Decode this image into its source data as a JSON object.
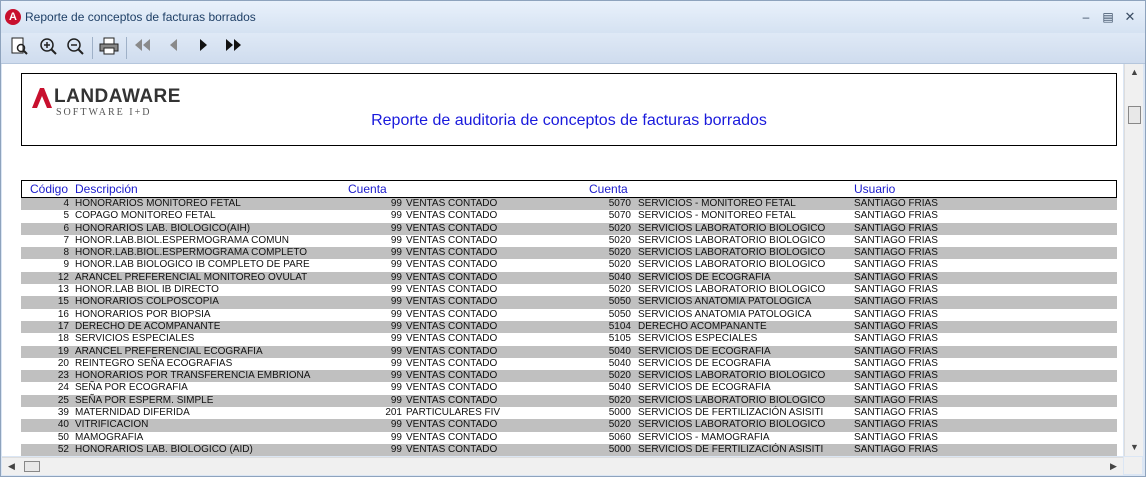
{
  "window": {
    "title": "Reporte de conceptos de facturas borrados",
    "app_icon_letter": "A"
  },
  "toolbar": {
    "icons": [
      "page-preview-icon",
      "zoom-in-icon",
      "zoom-out-icon",
      "print-icon",
      "first-page-icon",
      "previous-page-icon",
      "next-page-icon",
      "last-page-icon"
    ]
  },
  "report": {
    "logo_main": "LANDAWARE",
    "logo_sub": "SOFTWARE I+D",
    "title": "Reporte de auditoria de conceptos de facturas borrados",
    "columns": {
      "codigo": "Código",
      "descripcion": "Descripción",
      "cuenta1": "Cuenta",
      "cuenta2": "Cuenta",
      "usuario": "Usuario"
    },
    "rows": [
      {
        "codigo": "4",
        "descripcion": "HONORARIOS MONITOREO FETAL",
        "cuenta1_num": "99",
        "cuenta1_name": "VENTAS CONTADO",
        "cuenta2_num": "5070",
        "cuenta2_name": "SERVICIOS - MONITOREO FETAL",
        "usuario": "SANTIAGO FRIAS"
      },
      {
        "codigo": "5",
        "descripcion": "COPAGO MONITOREO FETAL",
        "cuenta1_num": "99",
        "cuenta1_name": "VENTAS CONTADO",
        "cuenta2_num": "5070",
        "cuenta2_name": "SERVICIOS - MONITOREO FETAL",
        "usuario": "SANTIAGO FRIAS"
      },
      {
        "codigo": "6",
        "descripcion": "HONORARIOS LAB. BIOLOGICO(AIH)",
        "cuenta1_num": "99",
        "cuenta1_name": "VENTAS CONTADO",
        "cuenta2_num": "5020",
        "cuenta2_name": "SERVICIOS LABORATORIO BIOLOGICO",
        "usuario": "SANTIAGO FRIAS"
      },
      {
        "codigo": "7",
        "descripcion": "HONOR.LAB.BIOL.ESPERMOGRAMA COMUN",
        "cuenta1_num": "99",
        "cuenta1_name": "VENTAS CONTADO",
        "cuenta2_num": "5020",
        "cuenta2_name": "SERVICIOS LABORATORIO BIOLOGICO",
        "usuario": "SANTIAGO FRIAS"
      },
      {
        "codigo": "8",
        "descripcion": "HONOR.LAB.BIOL.ESPERMOGRAMA COMPLETO",
        "cuenta1_num": "99",
        "cuenta1_name": "VENTAS CONTADO",
        "cuenta2_num": "5020",
        "cuenta2_name": "SERVICIOS LABORATORIO BIOLOGICO",
        "usuario": "SANTIAGO FRIAS"
      },
      {
        "codigo": "9",
        "descripcion": "HONOR.LAB BIOLOGICO IB COMPLETO DE PARE",
        "cuenta1_num": "99",
        "cuenta1_name": "VENTAS CONTADO",
        "cuenta2_num": "5020",
        "cuenta2_name": "SERVICIOS LABORATORIO BIOLOGICO",
        "usuario": "SANTIAGO FRIAS"
      },
      {
        "codigo": "12",
        "descripcion": "ARANCEL PREFERENCIAL  MONITOREO OVULAT",
        "cuenta1_num": "99",
        "cuenta1_name": "VENTAS CONTADO",
        "cuenta2_num": "5040",
        "cuenta2_name": "SERVICIOS DE ECOGRAFIA",
        "usuario": "SANTIAGO FRIAS"
      },
      {
        "codigo": "13",
        "descripcion": "HONOR.LAB BIOL IB DIRECTO",
        "cuenta1_num": "99",
        "cuenta1_name": "VENTAS CONTADO",
        "cuenta2_num": "5020",
        "cuenta2_name": "SERVICIOS LABORATORIO BIOLOGICO",
        "usuario": "SANTIAGO FRIAS"
      },
      {
        "codigo": "15",
        "descripcion": "HONORARIOS COLPOSCOPIA",
        "cuenta1_num": "99",
        "cuenta1_name": "VENTAS CONTADO",
        "cuenta2_num": "5050",
        "cuenta2_name": "SERVICIOS ANATOMIA PATOLOGICA",
        "usuario": "SANTIAGO FRIAS"
      },
      {
        "codigo": "16",
        "descripcion": "HONORARIOS POR BIOPSIA",
        "cuenta1_num": "99",
        "cuenta1_name": "VENTAS CONTADO",
        "cuenta2_num": "5050",
        "cuenta2_name": "SERVICIOS ANATOMIA PATOLOGICA",
        "usuario": "SANTIAGO FRIAS"
      },
      {
        "codigo": "17",
        "descripcion": "DERECHO DE ACOMPANANTE",
        "cuenta1_num": "99",
        "cuenta1_name": "VENTAS CONTADO",
        "cuenta2_num": "5104",
        "cuenta2_name": "DERECHO ACOMPANANTE",
        "usuario": "SANTIAGO FRIAS"
      },
      {
        "codigo": "18",
        "descripcion": "SERVICIOS ESPECIALES",
        "cuenta1_num": "99",
        "cuenta1_name": "VENTAS CONTADO",
        "cuenta2_num": "5105",
        "cuenta2_name": "SERVICIOS ESPECIALES",
        "usuario": "SANTIAGO FRIAS"
      },
      {
        "codigo": "19",
        "descripcion": "ARANCEL PREFERENCIAL ECOGRAFIA",
        "cuenta1_num": "99",
        "cuenta1_name": "VENTAS CONTADO",
        "cuenta2_num": "5040",
        "cuenta2_name": "SERVICIOS DE ECOGRAFIA",
        "usuario": "SANTIAGO FRIAS"
      },
      {
        "codigo": "20",
        "descripcion": "REINTEGRO SEÑA ECOGRAFIAS",
        "cuenta1_num": "99",
        "cuenta1_name": "VENTAS CONTADO",
        "cuenta2_num": "5040",
        "cuenta2_name": "SERVICIOS DE ECOGRAFIA",
        "usuario": "SANTIAGO FRIAS"
      },
      {
        "codigo": "23",
        "descripcion": "HONORARIOS POR TRANSFERENCIA EMBRIONA",
        "cuenta1_num": "99",
        "cuenta1_name": "VENTAS CONTADO",
        "cuenta2_num": "5020",
        "cuenta2_name": "SERVICIOS LABORATORIO BIOLOGICO",
        "usuario": "SANTIAGO FRIAS"
      },
      {
        "codigo": "24",
        "descripcion": "SEÑA POR ECOGRAFIA",
        "cuenta1_num": "99",
        "cuenta1_name": "VENTAS CONTADO",
        "cuenta2_num": "5040",
        "cuenta2_name": "SERVICIOS DE ECOGRAFIA",
        "usuario": "SANTIAGO FRIAS"
      },
      {
        "codigo": "25",
        "descripcion": "SEÑA POR ESPERM. SIMPLE",
        "cuenta1_num": "99",
        "cuenta1_name": "VENTAS CONTADO",
        "cuenta2_num": "5020",
        "cuenta2_name": "SERVICIOS LABORATORIO BIOLOGICO",
        "usuario": "SANTIAGO FRIAS"
      },
      {
        "codigo": "39",
        "descripcion": "MATERNIDAD DIFERIDA",
        "cuenta1_num": "201",
        "cuenta1_name": "PARTICULARES FIV",
        "cuenta2_num": "5000",
        "cuenta2_name": "SERVICIOS DE FERTILIZACIÓN ASISITI",
        "usuario": "SANTIAGO FRIAS"
      },
      {
        "codigo": "40",
        "descripcion": "VITRIFICACION",
        "cuenta1_num": "99",
        "cuenta1_name": "VENTAS CONTADO",
        "cuenta2_num": "5020",
        "cuenta2_name": "SERVICIOS LABORATORIO BIOLOGICO",
        "usuario": "SANTIAGO FRIAS"
      },
      {
        "codigo": "50",
        "descripcion": "MAMOGRAFIA",
        "cuenta1_num": "99",
        "cuenta1_name": "VENTAS CONTADO",
        "cuenta2_num": "5060",
        "cuenta2_name": "SERVICIOS - MAMOGRAFIA",
        "usuario": "SANTIAGO FRIAS"
      },
      {
        "codigo": "52",
        "descripcion": "HONORARIOS LAB. BIOLOGICO (AID)",
        "cuenta1_num": "99",
        "cuenta1_name": "VENTAS CONTADO",
        "cuenta2_num": "5000",
        "cuenta2_name": "SERVICIOS DE FERTILIZACIÓN ASISITI",
        "usuario": "SANTIAGO FRIAS"
      }
    ]
  }
}
